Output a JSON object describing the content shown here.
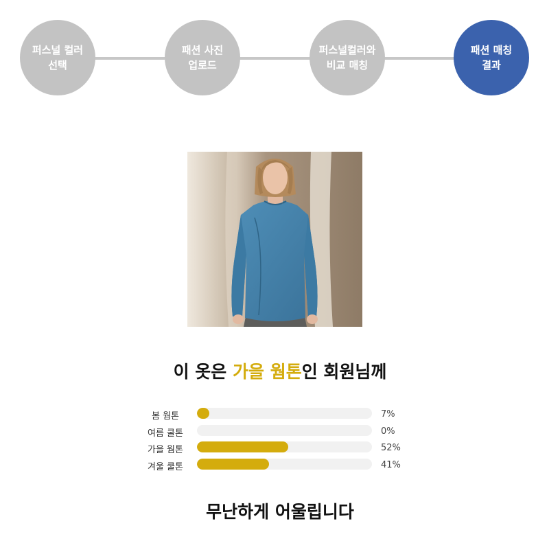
{
  "steps": [
    {
      "line1": "퍼스널 컬러",
      "line2": "선택",
      "active": false
    },
    {
      "line1": "패션 사진",
      "line2": "업로드",
      "active": false
    },
    {
      "line1": "퍼스널컬러와",
      "line2": "비교 매칭",
      "active": false
    },
    {
      "line1": "패션 매칭",
      "line2": "결과",
      "active": true
    }
  ],
  "headline": {
    "prefix": "이 옷은 ",
    "highlight": "가을 웜톤",
    "suffix": "인 회원님께"
  },
  "bars": [
    {
      "label": "봄 웜톤",
      "percent": 7,
      "display": "7%"
    },
    {
      "label": "여름 쿨톤",
      "percent": 0,
      "display": "0%"
    },
    {
      "label": "가을 웜톤",
      "percent": 52,
      "display": "52%"
    },
    {
      "label": "겨울 쿨톤",
      "percent": 41,
      "display": "41%"
    }
  ],
  "verdict": "무난하게 어울립니다",
  "colors": {
    "step_inactive": "#c3c3c3",
    "step_active": "#3b62ad",
    "accent": "#d4ac0d",
    "track": "#f1f1f1"
  }
}
